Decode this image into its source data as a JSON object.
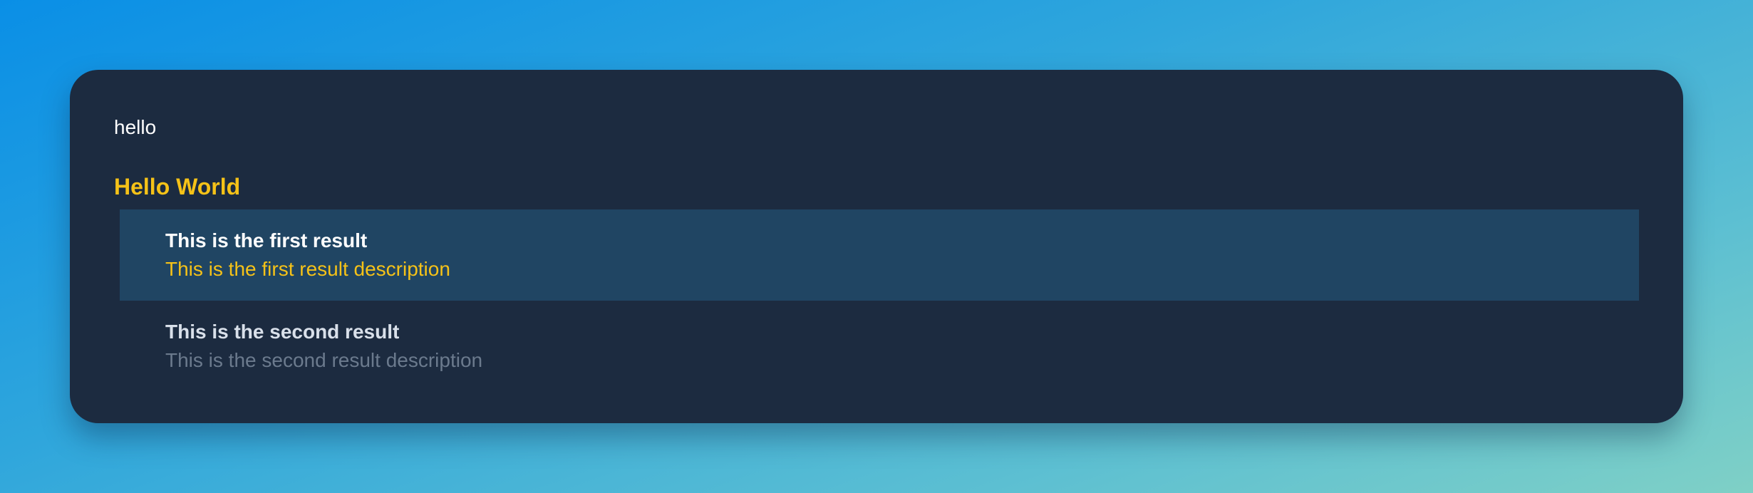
{
  "search": {
    "value": "hello"
  },
  "group": {
    "title": "Hello World"
  },
  "results": [
    {
      "title": "This is the first result",
      "description": "This is the first result description",
      "selected": true
    },
    {
      "title": "This is the second result",
      "description": "This is the second result description",
      "selected": false
    }
  ],
  "colors": {
    "accent": "#f5c218",
    "panel": "#1c2b40",
    "selected_row": "#204563",
    "muted_text": "#6b7a8d"
  }
}
